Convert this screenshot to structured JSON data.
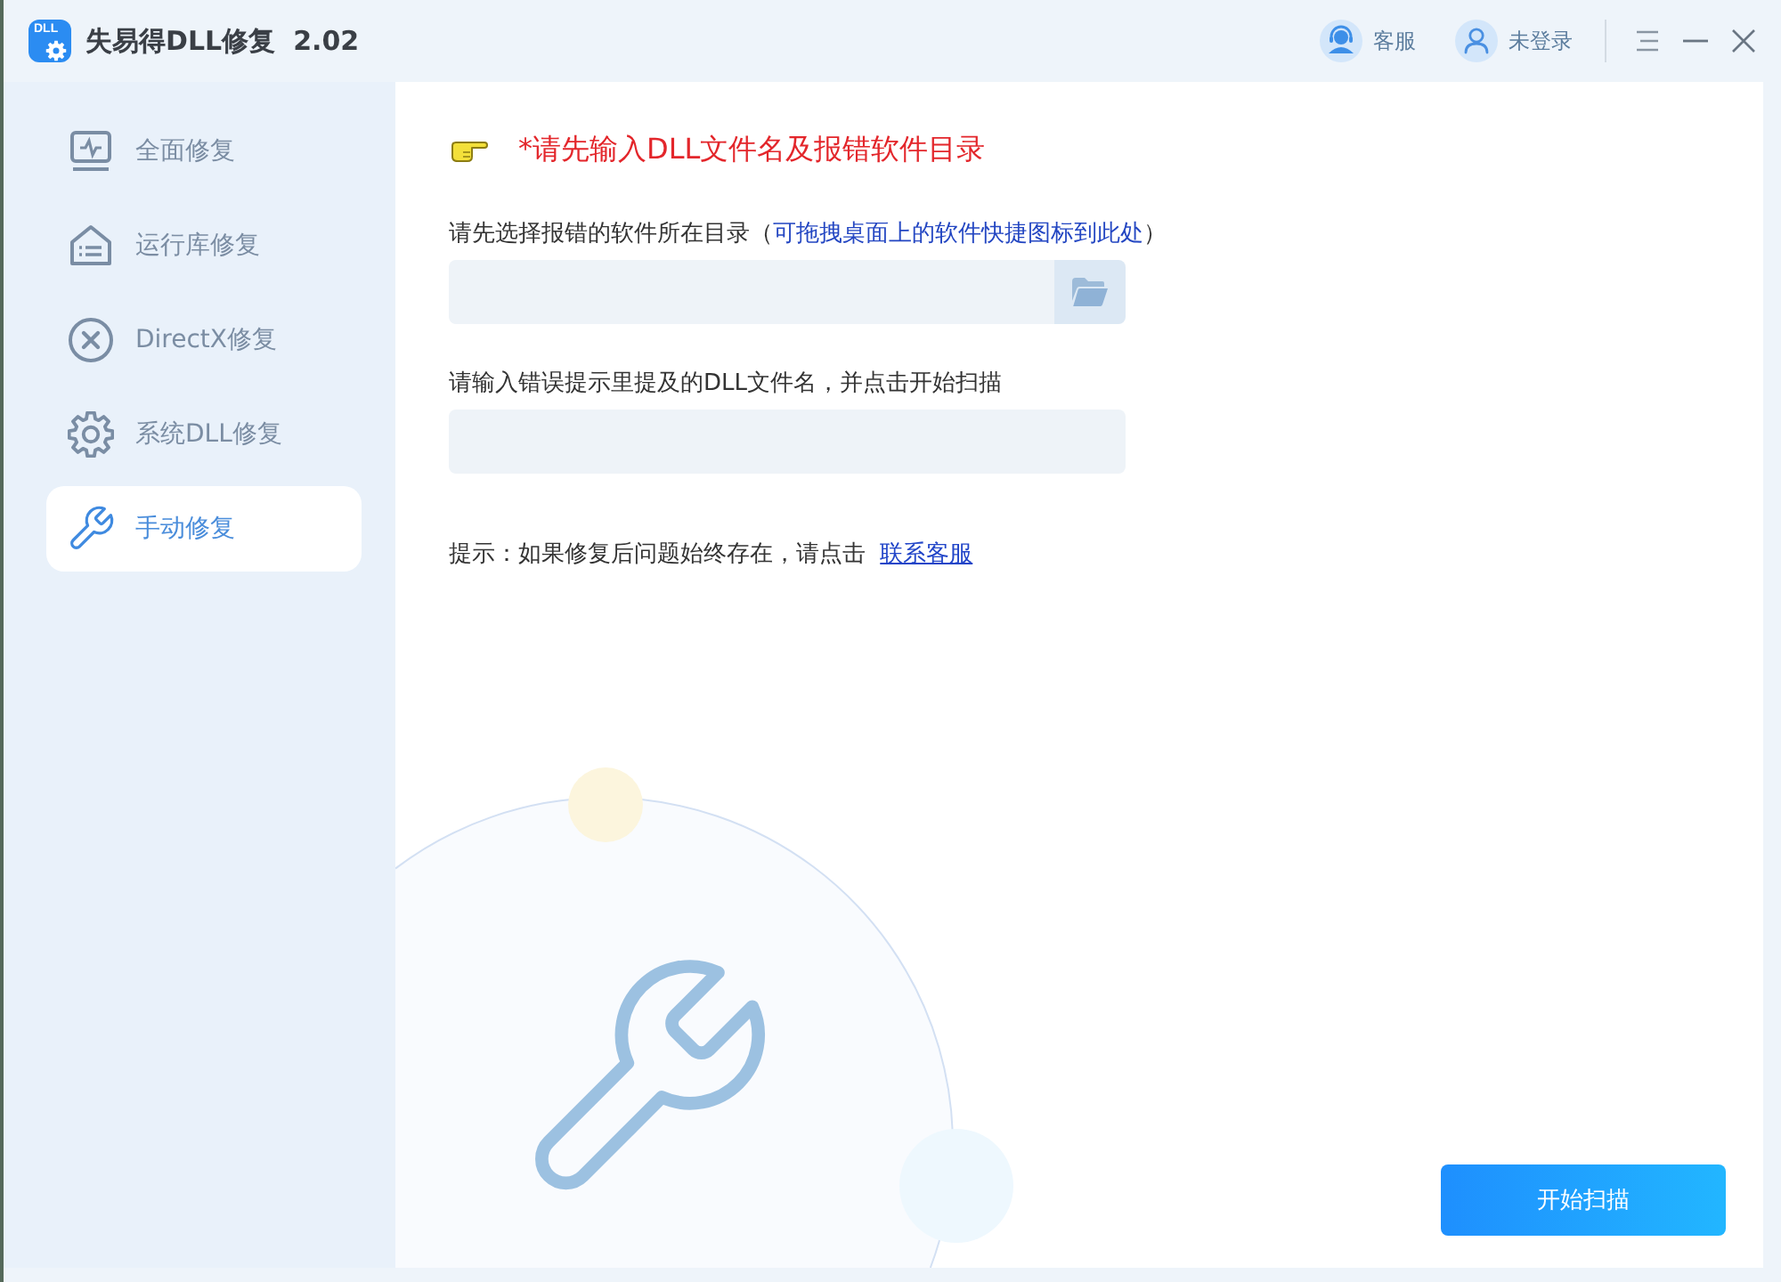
{
  "window": {
    "logo_text": "DLL",
    "title": "失易得DLL修复",
    "version": "2.02"
  },
  "header": {
    "actions": [
      {
        "kind": "support",
        "label": "客服"
      },
      {
        "kind": "account",
        "label": "未登录"
      }
    ]
  },
  "sidebar": {
    "items": [
      {
        "kind": "monitor",
        "label": "全面修复",
        "selected": false
      },
      {
        "kind": "library",
        "label": "运行库修复",
        "selected": false
      },
      {
        "kind": "directx",
        "label": "DirectX修复",
        "selected": false
      },
      {
        "kind": "gear",
        "label": "系统DLL修复",
        "selected": false
      },
      {
        "kind": "wrench",
        "label": "手动修复",
        "selected": true
      }
    ]
  },
  "main": {
    "notice": "*请先输入DLL文件名及报错软件目录",
    "directory": {
      "label_parts": [
        {
          "kind": "plain",
          "text": "请先选择报错的软件所在目录（"
        },
        {
          "kind": "hint",
          "text": "可拖拽桌面上的软件快捷图标到此处"
        },
        {
          "kind": "plain",
          "text": "）"
        }
      ]
    },
    "dll_name": {
      "label": "请输入错误提示里提及的DLL文件名，并点击开始扫描"
    },
    "tip": {
      "text": "提示：如果修复后问题始终存在，请点击",
      "link": "联系客服"
    },
    "scan_button": "开始扫描"
  }
}
